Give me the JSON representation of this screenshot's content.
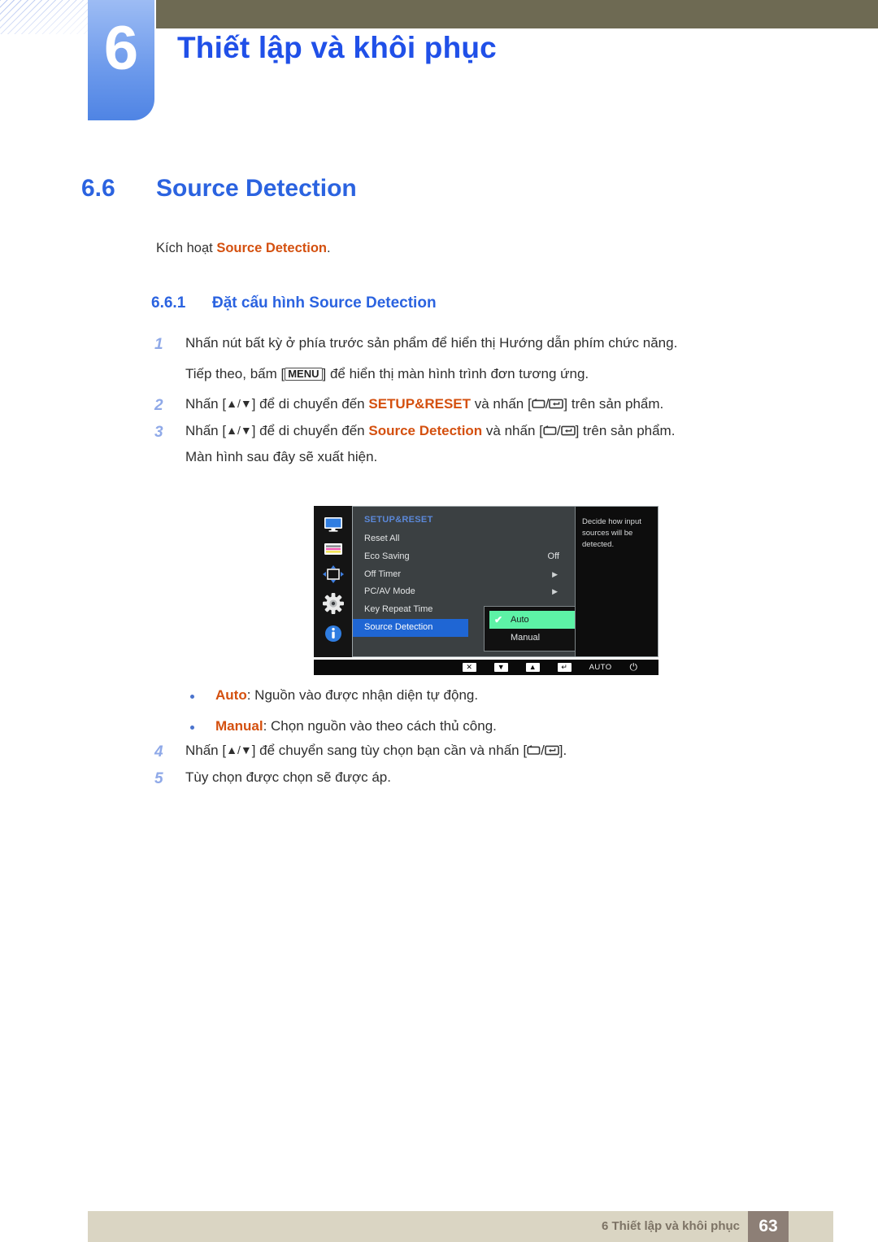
{
  "header": {
    "chapter_number": "6",
    "chapter_title": "Thiết lập và khôi phục",
    "badge_color": "#6e9bec",
    "bar_color": "#6e6a53"
  },
  "section": {
    "number": "6.6",
    "title": "Source Detection",
    "lead_prefix": "Kích hoạt ",
    "lead_keyword": "Source Detection",
    "lead_suffix": ".",
    "subsection_number": "6.6.1",
    "subsection_title": "Đặt cấu hình Source Detection"
  },
  "steps": [
    {
      "index": "1",
      "text": "Nhấn nút bất kỳ ở phía trước sản phẩm để hiển thị Hướng dẫn phím chức năng."
    },
    {
      "index": "2",
      "pre": "Nhấn [",
      "keys1": "▲/▼",
      "mid": "] để di chuyển đến ",
      "keyword": "SETUP&RESET",
      "mid2": " và nhấn [",
      "post": "] trên sản phẩm."
    },
    {
      "index": "3",
      "pre": "Nhấn [",
      "keys1": "▲/▼",
      "mid": "] để di chuyển đến ",
      "keyword": "Source Detection",
      "mid2": " và nhấn [",
      "post": "] trên sản phẩm."
    }
  ],
  "sub_texts": {
    "after_step1": "Tiếp theo, bấm [",
    "after_step1_key": "MENU",
    "after_step1_rest": "] để hiển thị màn hình trình đơn tương ứng.",
    "after_step3": "Màn hình sau đây sẽ xuất hiện."
  },
  "osd": {
    "title": "SETUP&RESET",
    "sidebar_icons": [
      "monitor-icon",
      "color-bars-icon",
      "size-position-icon",
      "gear-icon",
      "info-icon"
    ],
    "rows": [
      {
        "label": "Reset All",
        "value": "",
        "arrow": false,
        "selected": false
      },
      {
        "label": "Eco Saving",
        "value": "Off",
        "arrow": false,
        "selected": false
      },
      {
        "label": "Off Timer",
        "value": "",
        "arrow": true,
        "selected": false
      },
      {
        "label": "PC/AV Mode",
        "value": "",
        "arrow": true,
        "selected": false
      },
      {
        "label": "Key Repeat Time",
        "value": "",
        "arrow": false,
        "selected": false
      },
      {
        "label": "Source Detection",
        "value": "",
        "arrow": false,
        "selected": true
      }
    ],
    "description": "Decide how input sources will be detected.",
    "submenu": [
      {
        "label": "Auto",
        "checked": true
      },
      {
        "label": "Manual",
        "checked": false
      }
    ],
    "bottom_bar": {
      "close": "✕",
      "down": "▼",
      "up": "▲",
      "enter": "↵",
      "auto": "AUTO",
      "power": "⏻"
    },
    "highlight_color": "#1f66d4",
    "submenu_highlight_color": "#5df2a6"
  },
  "bullets": [
    {
      "keyword": "Auto",
      "text": ": Nguồn vào được nhận diện tự động."
    },
    {
      "keyword": "Manual",
      "text": ": Chọn nguồn vào theo cách thủ công."
    }
  ],
  "steps2": [
    {
      "index": "4",
      "pre": "Nhấn [",
      "keys1": "▲/▼",
      "mid": "] để chuyển sang tùy chọn bạn cần và nhấn [",
      "post": "]."
    },
    {
      "index": "5",
      "text": "Tùy chọn được chọn sẽ được áp."
    }
  ],
  "footer": {
    "text": "6 Thiết lập và khôi phục",
    "page": "63",
    "bar_color": "#dad5c3",
    "page_color": "#8d7f76"
  }
}
